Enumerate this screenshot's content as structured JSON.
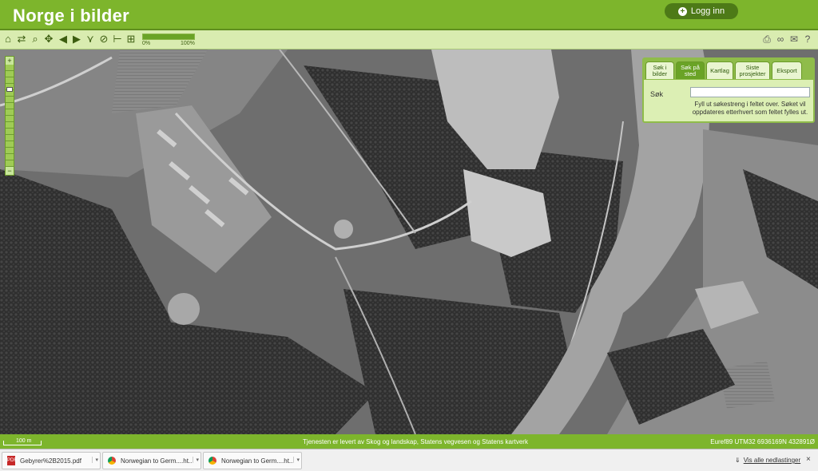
{
  "header": {
    "title": "Norge i bilder",
    "login_label": "Logg inn"
  },
  "toolbar": {
    "tools": [
      "home-icon",
      "refresh-icon",
      "zoom-box-icon",
      "pan-icon",
      "back-arrow-icon",
      "forward-arrow-icon",
      "measure-icon",
      "compass-icon",
      "ruler-icon",
      "layer-icon"
    ],
    "progress_start": "0%",
    "progress_end": "100%",
    "progress_value": 1.0,
    "right_tools": [
      "print-icon",
      "link-icon",
      "mail-icon",
      "help-icon"
    ]
  },
  "panel": {
    "tabs": [
      {
        "label": "Søk i bilder",
        "active": false
      },
      {
        "label": "Søk på sted",
        "active": true
      },
      {
        "label": "Kartlag",
        "active": false
      },
      {
        "label": "Siste prosjekter",
        "active": false
      },
      {
        "label": "Eksport",
        "active": false
      }
    ],
    "search_label": "Søk",
    "search_value": "",
    "help_text": "Fyll ut søkestreng i feltet over. Søket vil oppdateres etterhvert som feltet fylles ut."
  },
  "footer": {
    "scale": "100 m",
    "credits": "Tjenesten er levert av Skog og landskap, Statens vegvesen og Statens kartverk",
    "coords": "Euref89 UTM32 6936169N 432891Ø"
  },
  "downloads": {
    "items": [
      {
        "name": "Gebyrer%2B2015.pdf",
        "type": "pdf"
      },
      {
        "name": "Norwegian to Germ....ht...",
        "type": "chrome"
      },
      {
        "name": "Norwegian to Germ....ht...",
        "type": "chrome"
      }
    ],
    "show_all": "Vis alle nedlastinger",
    "close": "×"
  }
}
